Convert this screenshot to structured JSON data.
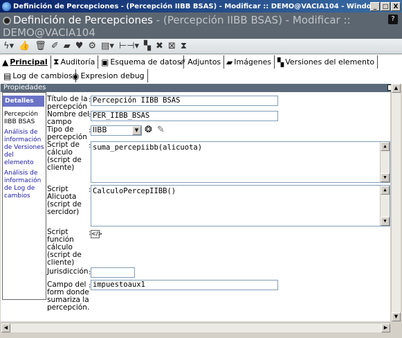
{
  "window": {
    "title": "Definición de Percepciones - (Percepción IIBB BSAS) - Modificar :: DEMO@VACIA104 - Windows Internet E...",
    "min": "_",
    "max": "□",
    "close": "X"
  },
  "header": {
    "title_main": "Definición de Percepciones",
    "title_sub": " - (Percepción IIBB BSAS) - Modificar ::",
    "title_line2": "DEMO@VACIA104",
    "help": "?"
  },
  "toolbar": {
    "icons": [
      "lightning-icon",
      "thumbs-up-icon",
      "trash-icon",
      "pin-icon",
      "folder-icon",
      "heart-icon",
      "chart-icon",
      "document-icon",
      "tree-icon",
      "binoculars-icon",
      "tools-icon",
      "window-icon",
      "hourglass-icon"
    ],
    "glyphs": [
      "ϟ▾",
      "👍",
      "🗑",
      "✐",
      "▰",
      "♥",
      "⚙",
      "▤▾",
      "⊢⊣▾",
      "▚",
      "✖",
      "⊠",
      "⧗"
    ]
  },
  "tabs": [
    {
      "label": "Principal",
      "icon": "▲",
      "active": true
    },
    {
      "label": "Auditoría",
      "icon": "⧗",
      "active": false
    },
    {
      "label": "Esquema de datos",
      "icon": "▣",
      "active": false
    },
    {
      "label": "Adjuntos",
      "icon": "✐",
      "active": false
    },
    {
      "label": "Imágenes",
      "icon": "▰",
      "active": false
    },
    {
      "label": "Versiones del elemento",
      "icon": "▚",
      "active": false
    },
    {
      "label": "Log de cambios",
      "icon": "▤",
      "active": false
    },
    {
      "label": "Expresion debug",
      "icon": "◉",
      "active": false
    }
  ],
  "properties": {
    "title": "Propiedades"
  },
  "sidebar": {
    "header": "Detalles",
    "current": "Percepción IIBB BSAS",
    "links": [
      "Análisis de información de Versiones del elemento",
      "Análisis de información de Log de cambios"
    ]
  },
  "form": {
    "titulo_label": "Título de la percepción",
    "titulo_value": "Percepción IIBB BSAS",
    "nombre_label": "Nombre del campo",
    "nombre_value": "PER_IIBB_BSAS",
    "tipo_label": "Tipo de percepción",
    "tipo_value": "IIBB",
    "script_calculo_label": "Script de cálculo (script de cliente)",
    "script_calculo_value": "suma_percepiibb(alicuota)",
    "script_alicuota_label": "Script Alicuota (script de sercidor)",
    "script_alicuota_value": "CalculoPercepIIBB()",
    "script_funcion_label": "Script función cálculo (script de cliente)",
    "jurisdiccion_label": "Jurisdicción",
    "jurisdiccion_value": "",
    "campo_form_label": "Campo del form donde sumariza la percepción.",
    "campo_form_value": "impuestoaux1"
  }
}
